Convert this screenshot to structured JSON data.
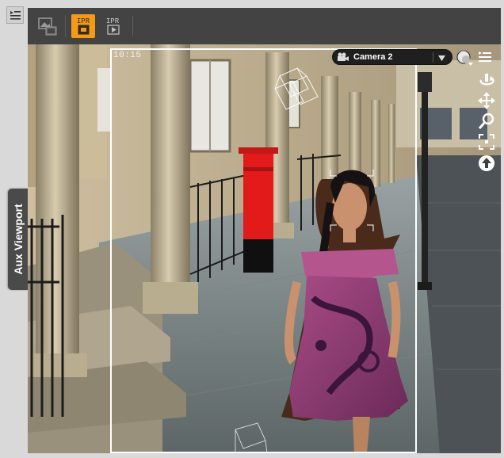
{
  "toolbar": {
    "buttons": [
      {
        "name": "render-snapshot-button",
        "label": ""
      },
      {
        "name": "ipr-button",
        "label": "IPR"
      },
      {
        "name": "ipr-playback-button",
        "label": "IPR"
      }
    ]
  },
  "side_tab": {
    "label": "Aux Viewport"
  },
  "viewport": {
    "timecode": "10:15",
    "camera": "Camera 2"
  },
  "colors": {
    "accent": "#f59a15",
    "panel": "#434343"
  },
  "icons": [
    "pane-menu-icon",
    "render-icon",
    "ipr-icon",
    "ipr-play-icon",
    "camera-icon",
    "dropdown-arrow-icon",
    "draw-style-icon",
    "options-menu-icon",
    "orbit-icon",
    "pan-icon",
    "zoom-icon",
    "frame-icon",
    "reset-icon"
  ]
}
